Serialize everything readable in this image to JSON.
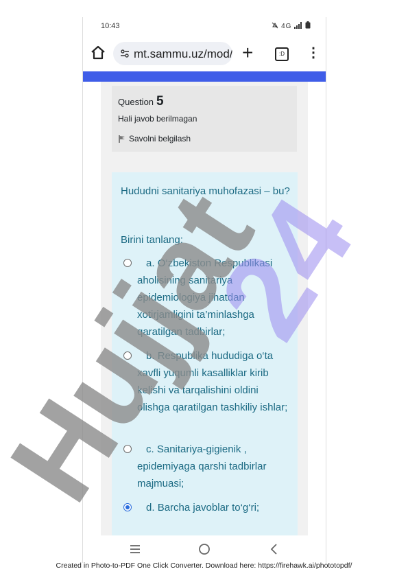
{
  "status_bar": {
    "time": "10:43",
    "icons_text": "4G"
  },
  "browser": {
    "url": "mt.sammu.uz/mod/q",
    "tabs_count": ":D"
  },
  "question": {
    "label": "Question",
    "number": "5",
    "state": "Hali javob berilmagan",
    "flag_label": "Savolni belgilash",
    "text": "Hududni sanitariya muhofazasi – bu?",
    "prompt": "Birini tanlang:",
    "options": [
      {
        "letter": "a.",
        "text": "O‘zbekiston Respublikasi aholisining sanitariya epidemiologiya jihatdan xotirjamligini ta’minlashga qaratilgan tadbirlar;",
        "selected": false
      },
      {
        "letter": "b.",
        "text": "Respublika hududiga o‘ta xavfli yuqumli kasalliklar kirib kelishi va tarqalishini oldini olishga qaratilgan tashkiliy ishlar;",
        "selected": false
      },
      {
        "letter": "c.",
        "text": "Sanitariya-gigienik , epidemiyaga qarshi tadbirlar majmuasi;",
        "selected": false
      },
      {
        "letter": "d.",
        "text": "Barcha javoblar to‘g‘ri;",
        "selected": true
      }
    ]
  },
  "watermark": {
    "text": "Hujjat24",
    "color_gray": "#8c8c8c",
    "color_purple": "#9b8cf0"
  },
  "footer": "Created in Photo-to-PDF One Click Converter. Download here: https://firehawk.ai/phototopdf/",
  "colors": {
    "accent_bar": "#3f5de8",
    "question_text": "#1b6a83",
    "answer_bg": "#def2f8",
    "info_bg": "#e7e7e7"
  }
}
